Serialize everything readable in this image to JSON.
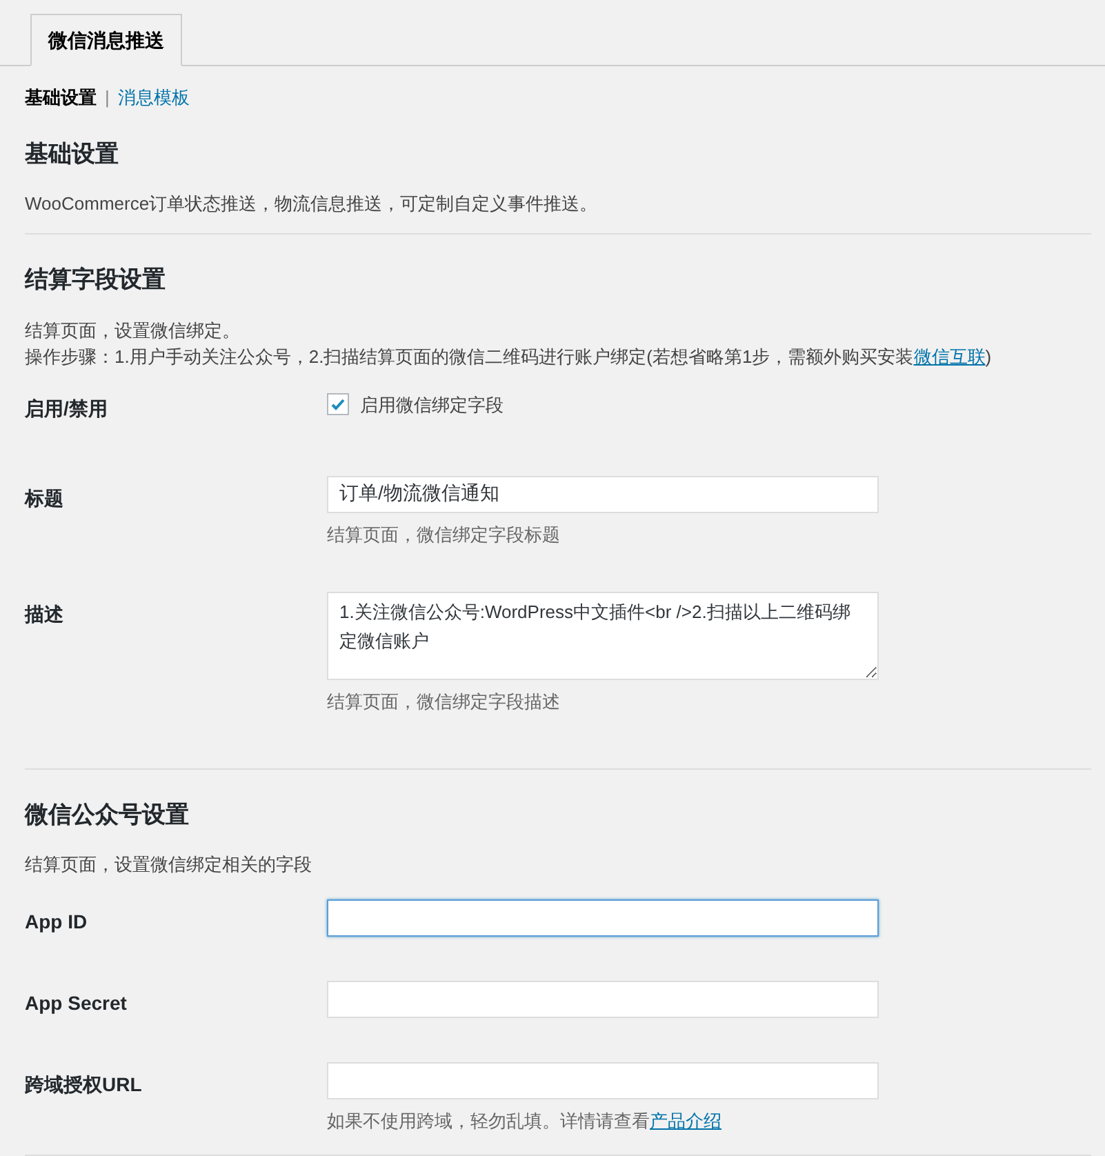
{
  "tabs": [
    {
      "label": "微信消息推送",
      "selected": true
    }
  ],
  "subnav": [
    {
      "label": "基础设置",
      "selected": true
    },
    {
      "label": "消息模板",
      "selected": false
    }
  ],
  "separator": "|",
  "sections": [
    {
      "title": "基础设置",
      "descriptions": [
        {
          "text": "WooCommerce订单状态推送，物流信息推送，可定制自定义事件推送。"
        }
      ]
    },
    {
      "title": "结算字段设置",
      "descriptions": [
        {
          "text": "结算页面，设置微信绑定。"
        },
        {
          "text": "操作步骤：1.用户手动关注公众号，2.扫描结算页面的微信二维码进行账户绑定(若想省略第1步，需额外购买安装",
          "link": "微信互联",
          "after": ")"
        }
      ],
      "fields": [
        {
          "kind": "checkbox",
          "label": "启用/禁用",
          "checked": true,
          "option": "启用微信绑定字段"
        },
        {
          "kind": "text",
          "label": "标题",
          "value": "订单/物流微信通知",
          "focused": false,
          "help": {
            "text": "结算页面，微信绑定字段标题"
          }
        },
        {
          "kind": "textarea",
          "label": "描述",
          "value": "1.关注微信公众号:WordPress中文插件<br />2.扫描以上二维码绑定微信账户",
          "focused": false,
          "help": {
            "text": "结算页面，微信绑定字段描述"
          }
        }
      ]
    },
    {
      "title": "微信公众号设置",
      "descriptions": [
        {
          "text": "结算页面，设置微信绑定相关的字段"
        }
      ],
      "fields": [
        {
          "kind": "text",
          "label": "App ID",
          "focused": true
        },
        {
          "kind": "text",
          "label": "App Secret",
          "focused": false
        },
        {
          "kind": "text",
          "label": "跨域授权URL",
          "focused": false,
          "help": {
            "text": "如果不使用跨域，轻勿乱填。详情请查看",
            "link": "产品介绍"
          }
        }
      ]
    }
  ]
}
